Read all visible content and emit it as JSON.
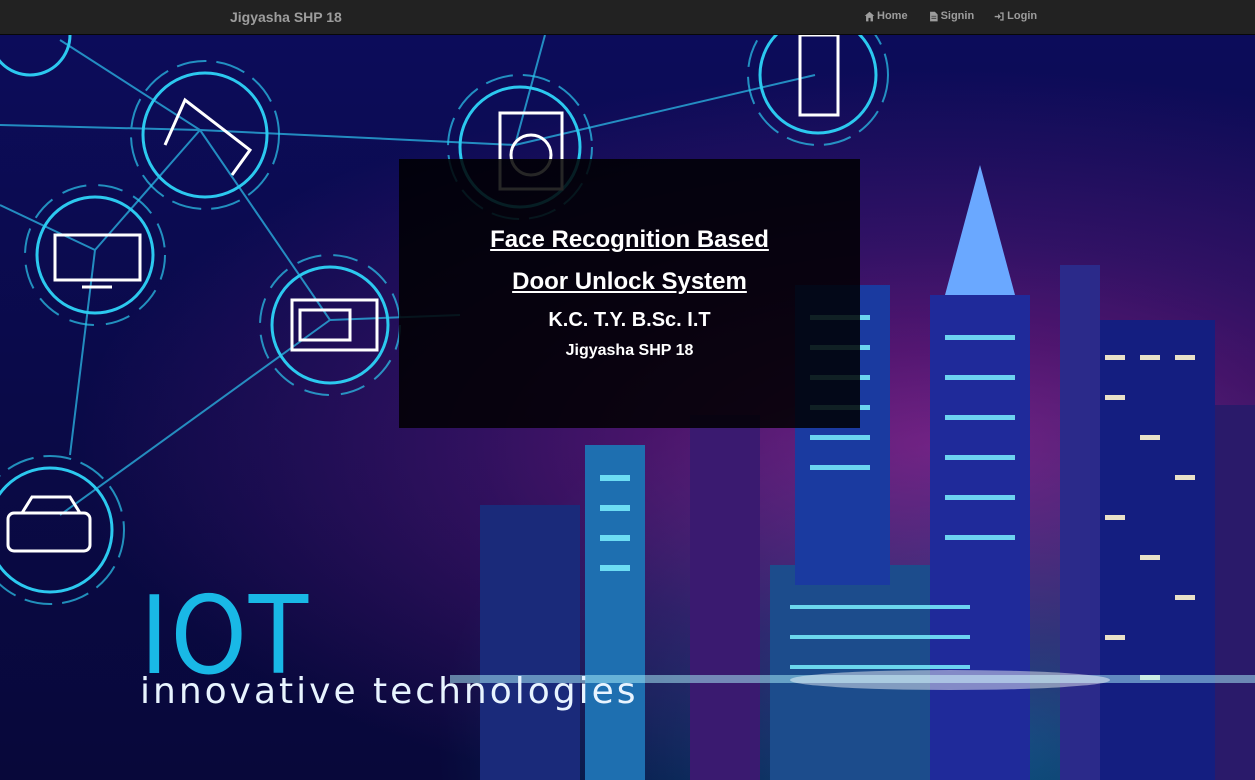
{
  "navbar": {
    "brand": "Jigyasha SHP 18",
    "links": [
      {
        "label": "Home",
        "icon": "home-icon"
      },
      {
        "label": "Signin",
        "icon": "file-icon"
      },
      {
        "label": "Login",
        "icon": "login-icon"
      }
    ]
  },
  "hero": {
    "title_line1": "Face Recognition Based",
    "title_line2": "Door Unlock System",
    "subtitle": "K.C. T.Y. B.Sc. I.T",
    "author": "Jigyasha SHP 18"
  },
  "background": {
    "logo_text": "IOT",
    "logo_tagline": "innovative technologies"
  },
  "colors": {
    "navbar_bg": "#222222",
    "nav_text": "#9d9d9d",
    "neon_cyan": "#19b8e6",
    "neon_magenta": "#d42fc0"
  }
}
